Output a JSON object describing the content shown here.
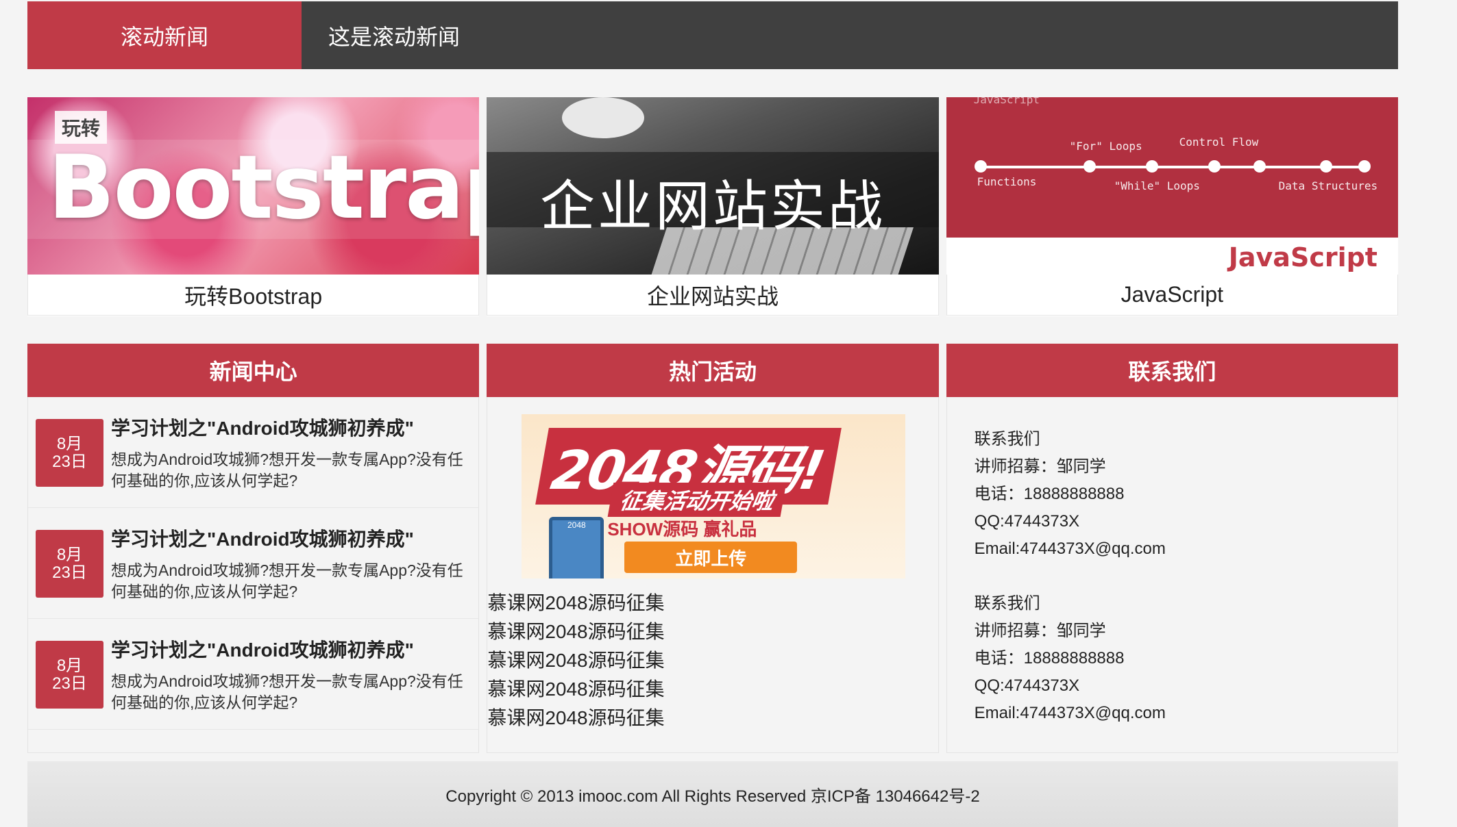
{
  "ticker": {
    "label": "滚动新闻",
    "text": "这是滚动新闻"
  },
  "courses": [
    {
      "image_tag": "玩转",
      "image_title": "Bootstrap",
      "caption": "玩转Bootstrap"
    },
    {
      "image_title": "企业网站实战",
      "caption": "企业网站实战"
    },
    {
      "image_top_text": "JavaScript",
      "image_labels": [
        "Functions",
        "\"For\" Loops",
        "\"While\" Loops",
        "Control Flow",
        "Data Structures"
      ],
      "image_title": "JavaScript",
      "caption": "JavaScript"
    }
  ],
  "news": {
    "title": "新闻中心",
    "items": [
      {
        "month": "8月",
        "day": "23日",
        "title": "学习计划之\"Android攻城狮初养成\"",
        "body": "想成为Android攻城狮?想开发一款专属App?没有任何基础的你,应该从何学起?"
      },
      {
        "month": "8月",
        "day": "23日",
        "title": "学习计划之\"Android攻城狮初养成\"",
        "body": "想成为Android攻城狮?想开发一款专属App?没有任何基础的你,应该从何学起?"
      },
      {
        "month": "8月",
        "day": "23日",
        "title": "学习计划之\"Android攻城狮初养成\"",
        "body": "想成为Android攻城狮?想开发一款专属App?没有任何基础的你,应该从何学起?"
      }
    ]
  },
  "activities": {
    "title": "热门活动",
    "promo": {
      "headline": "2048源码!",
      "subline": "征集活动开始啦",
      "show": "SHOW源码 赢礼品",
      "button": "立即上传",
      "phone_text": "2048"
    },
    "items": [
      "慕课网2048源码征集",
      "慕课网2048源码征集",
      "慕课网2048源码征集",
      "慕课网2048源码征集",
      "慕课网2048源码征集"
    ]
  },
  "contact": {
    "title": "联系我们",
    "groups": [
      {
        "heading": "联系我们",
        "lecturer": "讲师招募：邹同学",
        "phone": "电话：18888888888",
        "qq": "QQ:4744373X",
        "email": "Email:4744373X@qq.com"
      },
      {
        "heading": "联系我们",
        "lecturer": "讲师招募：邹同学",
        "phone": "电话：18888888888",
        "qq": "QQ:4744373X",
        "email": "Email:4744373X@qq.com"
      }
    ]
  },
  "footer": {
    "copyright": "Copyright © 2013 imooc.com All Rights Reserved 京ICP备 13046642号-2"
  },
  "colors": {
    "accent": "#c03a47",
    "ticker_bg": "#404040",
    "page_bg": "#f4f4f4"
  }
}
